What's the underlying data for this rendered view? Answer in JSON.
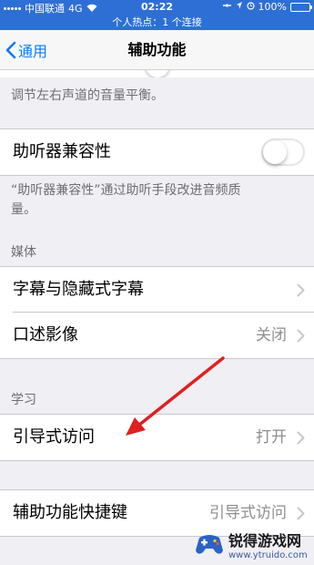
{
  "status_bar": {
    "carrier": "中国联通",
    "network": "4G",
    "time": "02:22",
    "battery": "100%"
  },
  "hotspot": "个人热点：1 个连接",
  "nav": {
    "back_label": "通用",
    "title": "辅助功能"
  },
  "balance_footer": "调节左右声道的音量平衡。",
  "hearing_aid": {
    "label": "助听器兼容性",
    "on": false,
    "footer": "“助听器兼容性”通过助听手段改进音频质量。"
  },
  "media": {
    "header": "媒体",
    "items": [
      {
        "label": "字幕与隐藏式字幕",
        "value": ""
      },
      {
        "label": "口述影像",
        "value": "关闭"
      }
    ]
  },
  "learning": {
    "header": "学习",
    "items": [
      {
        "label": "引导式访问",
        "value": "打开"
      }
    ]
  },
  "shortcut": {
    "label": "辅助功能快捷键",
    "value": "引导式访问"
  },
  "watermark": {
    "name": "锐得游戏网",
    "url": "www.ytruido.com"
  },
  "colors": {
    "accent": "#0a7aff",
    "status_bar": "#2e6fd6",
    "arrow": "#e02020"
  }
}
